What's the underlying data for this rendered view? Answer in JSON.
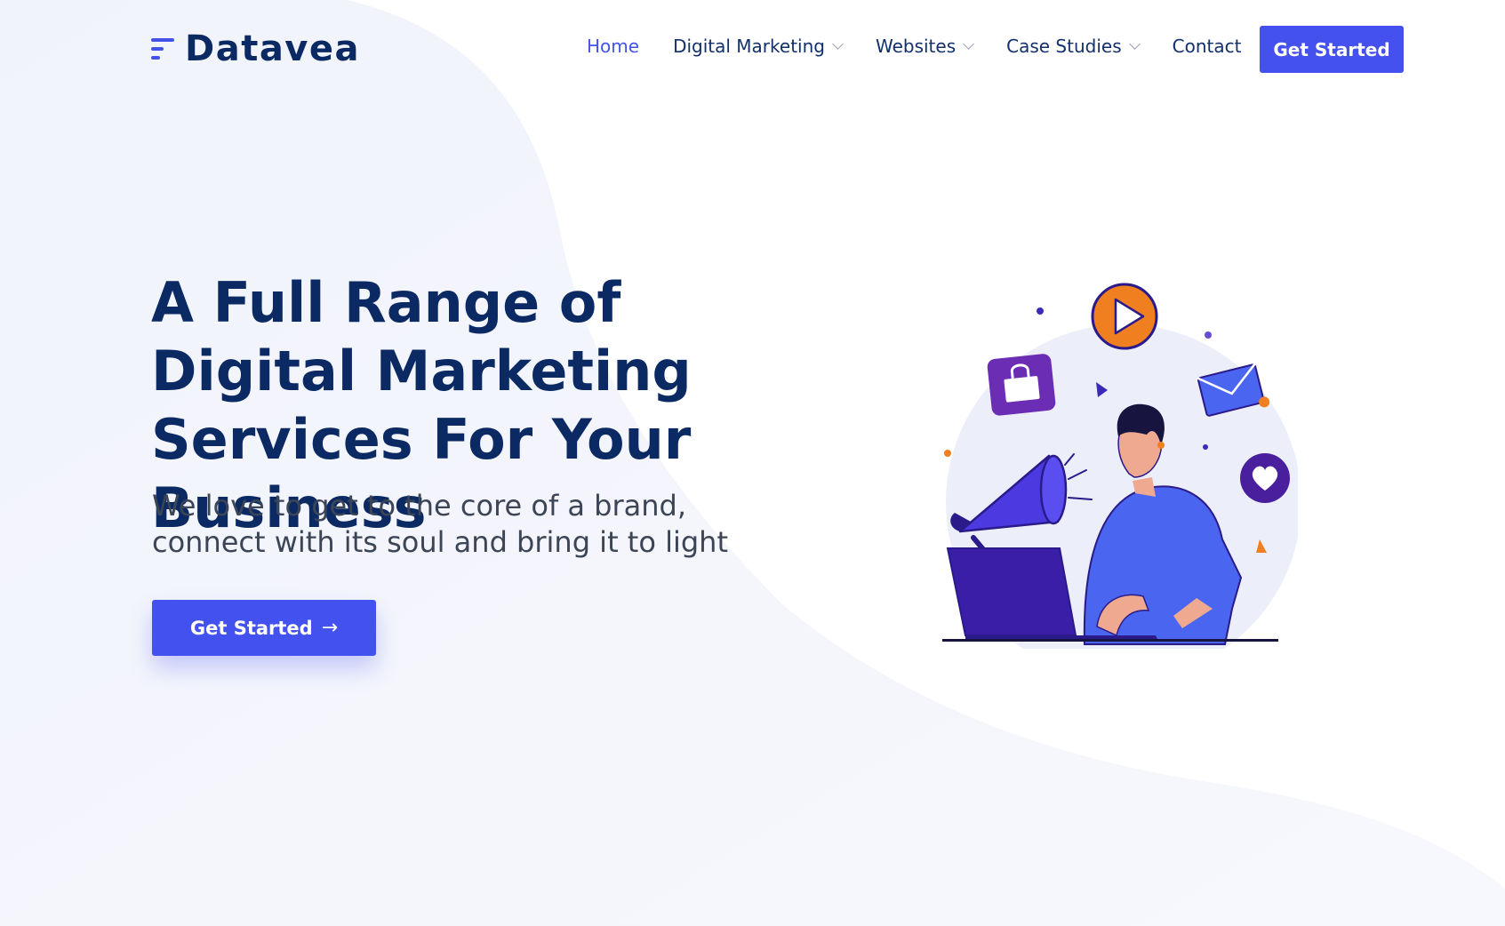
{
  "brand": {
    "name": "Datavea",
    "accent": "#4353ea",
    "heading_color": "#0b2a63"
  },
  "nav": {
    "items": [
      {
        "label": "Home",
        "active": true,
        "dropdown": false
      },
      {
        "label": "Digital Marketing",
        "active": false,
        "dropdown": true
      },
      {
        "label": "Websites",
        "active": false,
        "dropdown": true
      },
      {
        "label": "Case Studies",
        "active": false,
        "dropdown": true
      },
      {
        "label": "Contact",
        "active": false,
        "dropdown": false
      }
    ],
    "cta_label": "Get Started"
  },
  "hero": {
    "title": "A Full Range of Digital Marketing Services For Your Business",
    "subtitle": "We love to get to the core of a brand, connect with its soul and bring it to light",
    "button_label": "Get Started",
    "button_icon": "arrow-right-icon"
  },
  "illustration": {
    "icons": [
      "play-icon",
      "shopping-bag-icon",
      "envelope-icon",
      "heart-icon",
      "megaphone-icon",
      "laptop-icon"
    ],
    "colors": {
      "orange": "#f07f1f",
      "purple": "#6c2bb3",
      "blue": "#4a66f0",
      "navy": "#2a1a8a"
    }
  }
}
